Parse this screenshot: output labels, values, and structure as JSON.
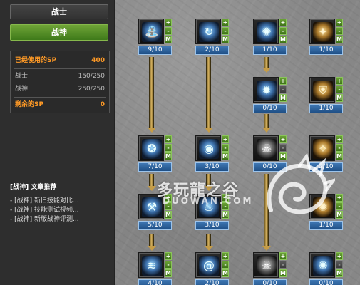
{
  "left_panel": {
    "class_title": "战士",
    "subclass_button": "战神",
    "sp": {
      "used_label": "已经使用的SP",
      "used_value": "400",
      "rows": [
        {
          "label": "战士",
          "value": "150/250"
        },
        {
          "label": "战神",
          "value": "250/250"
        }
      ],
      "remaining_label": "剩余的SP",
      "remaining_value": "0"
    },
    "articles": {
      "title": "[战神] 文章推荐",
      "items": [
        "- [战神] 新旧技能对比...",
        "- [战神] 技能测试视频...",
        "- [战神] 新版战神评测..."
      ]
    }
  },
  "skill_tree": {
    "skills": [
      {
        "id": "r1c1",
        "level": "9/10",
        "icon": "blue-fountain-icon",
        "glyph": "⛲",
        "plus": "+",
        "minus": "-",
        "max": "M"
      },
      {
        "id": "r1c2",
        "level": "2/10",
        "icon": "blue-whirl-icon",
        "glyph": "↻",
        "plus": "+",
        "minus": "-",
        "max": "M"
      },
      {
        "id": "r1c3",
        "level": "1/10",
        "icon": "blue-spirit-icon",
        "glyph": "✺",
        "plus": "+",
        "minus": "-",
        "max": "M"
      },
      {
        "id": "r1c4",
        "level": "1/10",
        "icon": "gold-strike-icon",
        "glyph": "✦",
        "plus": "+",
        "minus": "-",
        "max": "M"
      },
      {
        "id": "r2c3",
        "level": "0/10",
        "icon": "blue-burst-icon",
        "glyph": "✹",
        "plus": "+",
        "minus": "-",
        "max": "M"
      },
      {
        "id": "r2c4",
        "level": "1/10",
        "icon": "gold-shield-icon",
        "glyph": "⛨",
        "plus": "+",
        "minus": "-",
        "max": "M"
      },
      {
        "id": "r3c1",
        "level": "7/10",
        "icon": "blue-slash-icon",
        "glyph": "✪",
        "plus": "+",
        "minus": "-",
        "max": "M"
      },
      {
        "id": "r3c2",
        "level": "3/10",
        "icon": "blue-orb-icon",
        "glyph": "◉",
        "plus": "+",
        "minus": "-",
        "max": "M"
      },
      {
        "id": "r3c3",
        "level": "0/10",
        "icon": "grey-skull-icon",
        "glyph": "☠",
        "plus": "+",
        "minus": "-",
        "max": "M"
      },
      {
        "id": "r3c4",
        "level": "2/10",
        "icon": "gold-swirl-icon",
        "glyph": "✧",
        "plus": "+",
        "minus": "-",
        "max": "M"
      },
      {
        "id": "r4c1",
        "level": "5/10",
        "icon": "blue-axe-icon",
        "glyph": "⚒",
        "plus": "+",
        "minus": "-",
        "max": "M"
      },
      {
        "id": "r4c2",
        "level": "3/10",
        "icon": "blue-flame-icon",
        "glyph": "♨",
        "plus": "+",
        "minus": "-",
        "max": "M"
      },
      {
        "id": "r4c4",
        "level": "1/10",
        "icon": "gold-spin-icon",
        "glyph": "✺",
        "plus": "+",
        "minus": "-",
        "max": "M"
      },
      {
        "id": "r5c1",
        "level": "4/10",
        "icon": "blue-wave-icon",
        "glyph": "≋",
        "plus": "+",
        "minus": "-",
        "max": "M"
      },
      {
        "id": "r5c2",
        "level": "2/10",
        "icon": "blue-cyclone-icon",
        "glyph": "@",
        "plus": "+",
        "minus": "-",
        "max": "M"
      },
      {
        "id": "r5c3",
        "level": "0/10",
        "icon": "grey-skull-icon",
        "glyph": "☠",
        "plus": "+",
        "minus": "-",
        "max": "M"
      },
      {
        "id": "r5c4",
        "level": "0/10",
        "icon": "blue-spirit-icon",
        "glyph": "✺",
        "plus": "+",
        "minus": "-",
        "max": "M"
      }
    ]
  },
  "watermark": {
    "text": "多玩龍之谷",
    "sub": "DUOWAN.COM"
  }
}
